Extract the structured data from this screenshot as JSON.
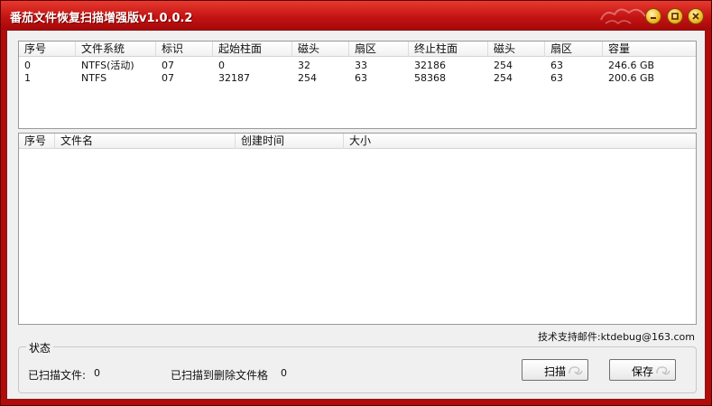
{
  "window": {
    "title": "番茄文件恢复扫描增强版v1.0.0.2"
  },
  "partitions": {
    "columns": [
      "序号",
      "文件系统",
      "标识",
      "起始柱面",
      "磁头",
      "扇区",
      "终止柱面",
      "磁头",
      "扇区",
      "容量"
    ],
    "rows": [
      [
        "0",
        "NTFS(活动)",
        "07",
        "0",
        "32",
        "33",
        "32186",
        "254",
        "63",
        "246.6 GB"
      ],
      [
        "1",
        "NTFS",
        "07",
        "32187",
        "254",
        "63",
        "58368",
        "254",
        "63",
        "200.6 GB"
      ]
    ]
  },
  "files": {
    "columns": [
      "序号",
      "文件名",
      "创建时间",
      "大小"
    ],
    "rows": []
  },
  "support": {
    "text": "技术支持邮件:ktdebug@163.com"
  },
  "status": {
    "group_label": "状态",
    "scanned_label": "已扫描文件:",
    "scanned_value": "0",
    "deleted_label": "已扫描到删除文件格",
    "deleted_value": "0"
  },
  "buttons": {
    "scan": "扫描",
    "save": "保存"
  },
  "colors": {
    "title_bar": "#c41414",
    "frame": "#b00c0c",
    "window_button": "#f7c63a"
  }
}
